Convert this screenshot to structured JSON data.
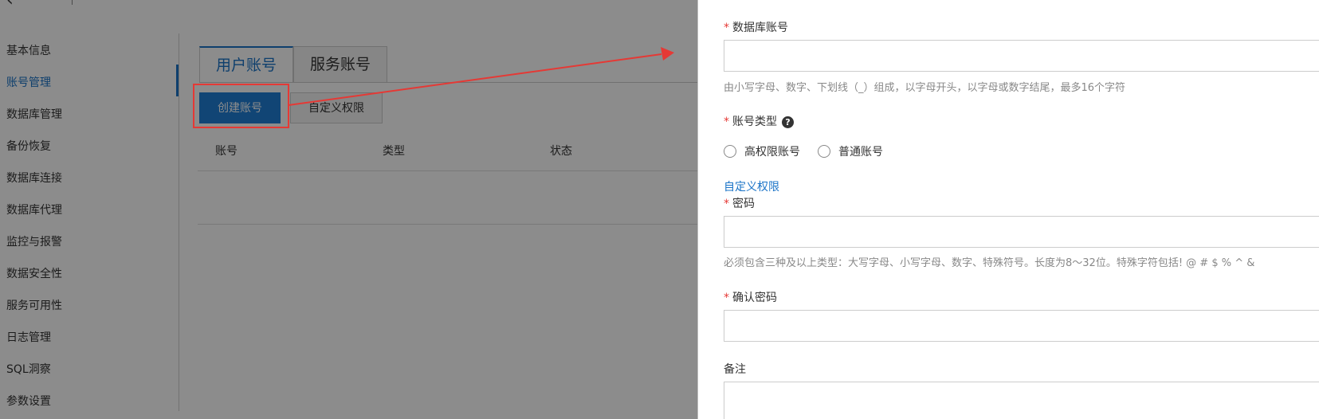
{
  "topbar": {
    "back_icon": "back-arrow-icon",
    "title": "..."
  },
  "sidebar": {
    "items": [
      {
        "label": "基本信息"
      },
      {
        "label": "账号管理"
      },
      {
        "label": "数据库管理"
      },
      {
        "label": "备份恢复"
      },
      {
        "label": "数据库连接"
      },
      {
        "label": "数据库代理"
      },
      {
        "label": "监控与报警"
      },
      {
        "label": "数据安全性"
      },
      {
        "label": "服务可用性"
      },
      {
        "label": "日志管理"
      },
      {
        "label": "SQL洞察"
      },
      {
        "label": "参数设置"
      }
    ]
  },
  "tabs": [
    {
      "label": "用户账号"
    },
    {
      "label": "服务账号"
    }
  ],
  "toolbar": {
    "create_label": "创建账号",
    "custom_label": "自定义权限"
  },
  "table": {
    "columns": [
      "账号",
      "类型",
      "状态"
    ]
  },
  "drawer": {
    "account": {
      "label": "数据库账号",
      "hint": "由小写字母、数字、下划线（_）组成，以字母开头，以字母或数字结尾，最多16个字符"
    },
    "type": {
      "label": "账号类型",
      "options": [
        {
          "label": "高权限账号"
        },
        {
          "label": "普通账号"
        }
      ]
    },
    "custom_link": "自定义权限",
    "password": {
      "label": "密码",
      "hint": "必须包含三种及以上类型：大写字母、小写字母、数字、特殊符号。长度为8～32位。特殊字符包括! @ # $ % ^ &"
    },
    "confirm": {
      "label": "确认密码"
    },
    "remark": {
      "label": "备注"
    }
  },
  "colors": {
    "accent": "#1a73c7",
    "primary_button": "#1f7ed6",
    "required": "#e53935",
    "annotation": "#e53935"
  }
}
